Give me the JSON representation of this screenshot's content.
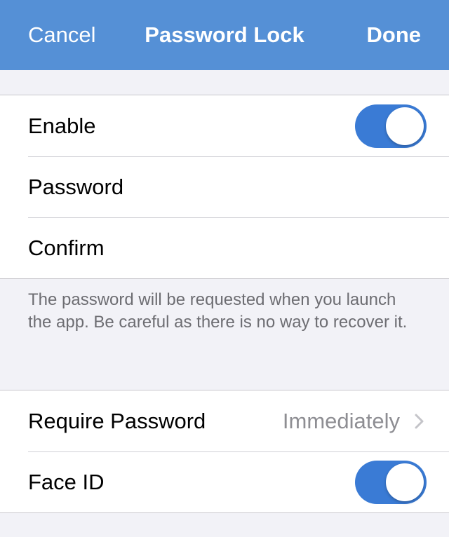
{
  "navbar": {
    "cancel_label": "Cancel",
    "title": "Password Lock",
    "done_label": "Done",
    "background": "#5590d6"
  },
  "group1": {
    "enable": {
      "label": "Enable",
      "toggle_on": true
    },
    "password": {
      "label": "Password"
    },
    "confirm": {
      "label": "Confirm"
    }
  },
  "note": "The password will be requested when you launch the app. Be careful as there is no way to recover it.",
  "group2": {
    "require_password": {
      "label": "Require Password",
      "value": "Immediately",
      "icon": "chevron-right-icon"
    },
    "face_id": {
      "label": "Face ID",
      "toggle_on": true
    }
  },
  "colors": {
    "toggle_on": "#3a7bd5",
    "secondary_text": "#8e8e93",
    "background": "#f2f2f7"
  }
}
